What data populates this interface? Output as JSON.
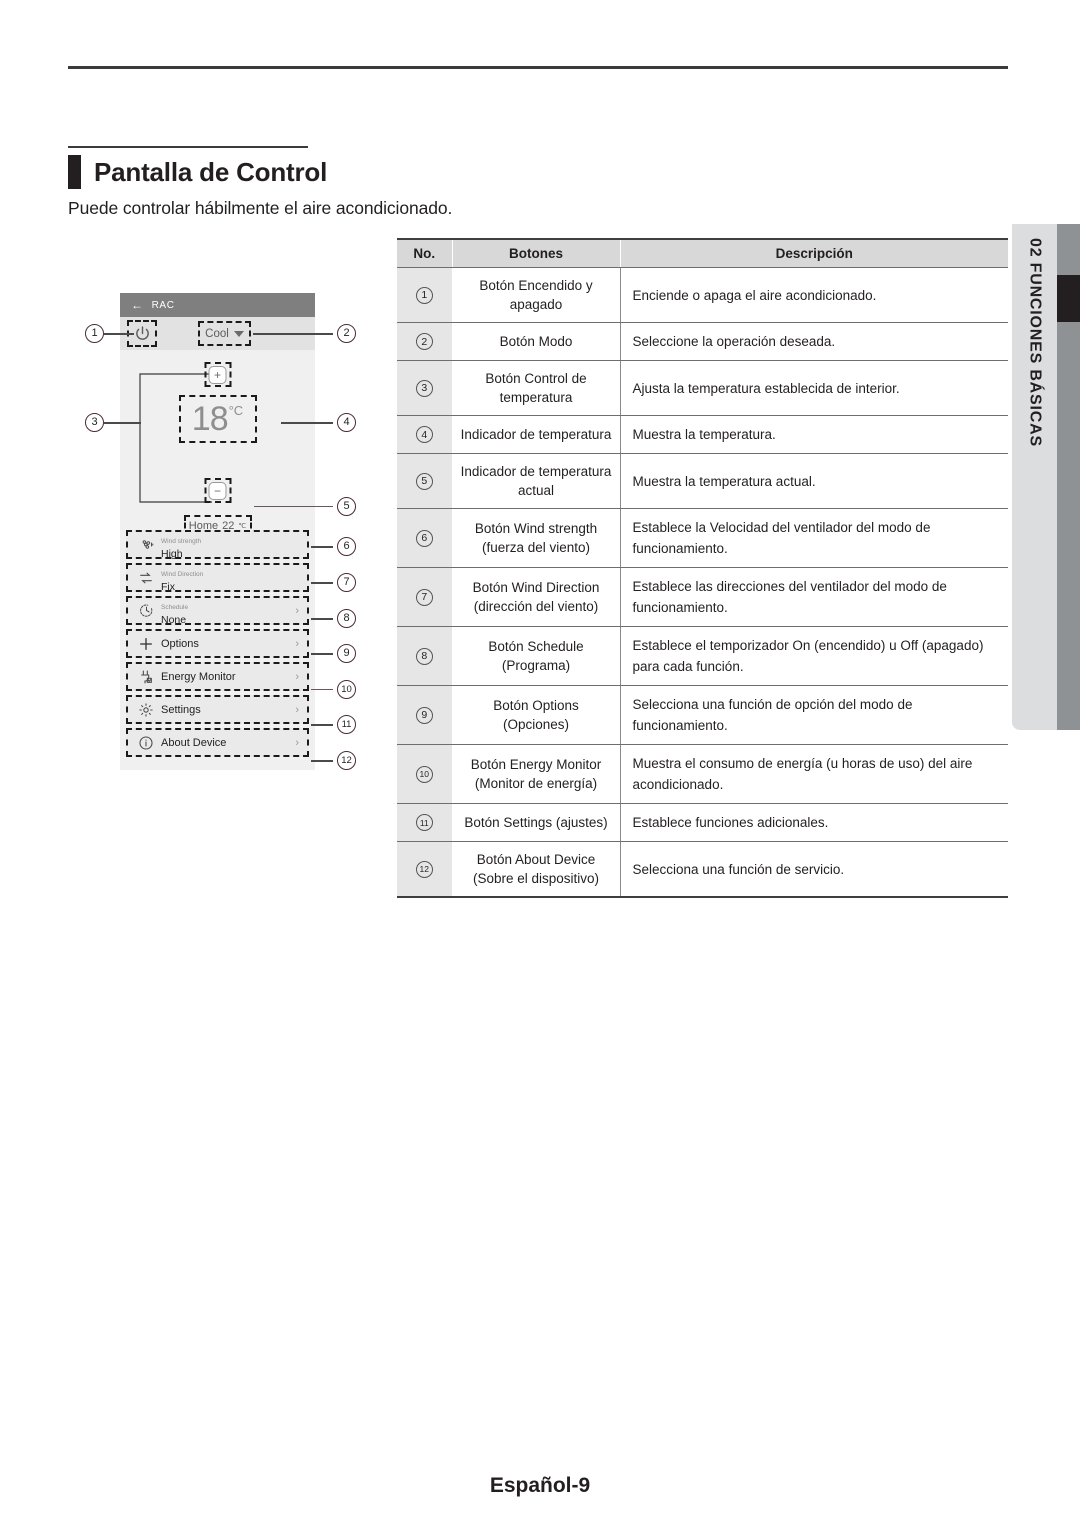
{
  "page": {
    "heading": "Pantalla de Control",
    "subtitle": "Puede controlar hábilmente el aire acondicionado.",
    "footer": "Español-9"
  },
  "sidebar": {
    "chapter_number": "02",
    "chapter_title": "FUNCIONES BÁSICAS",
    "label": "02  FUNCIONES BÁSICAS"
  },
  "mockup": {
    "appbar": {
      "back_icon": "back-arrow-icon",
      "title": "RAC"
    },
    "toolbar": {
      "power_icon": "power-icon",
      "mode_value": "Cool",
      "mode_caret": "chevron-down-icon"
    },
    "temperature": {
      "increase_label": "+",
      "decrease_label": "−",
      "set_value": "18",
      "set_unit": "°C",
      "current_label": "Home",
      "current_value": "22",
      "current_unit": "℃"
    },
    "list": [
      {
        "icon": "fan-icon",
        "label": "Wind strength",
        "value": "High",
        "chevron": false
      },
      {
        "icon": "arrows-icon",
        "label": "Wind Direction",
        "value": "Fix",
        "chevron": false
      },
      {
        "icon": "clock-icon",
        "label": "Schedule",
        "value": "None",
        "chevron": true
      },
      {
        "icon": "plus-icon",
        "label": "",
        "value": "Options",
        "chevron": true
      },
      {
        "icon": "plug-icon",
        "label": "",
        "value": "Energy Monitor",
        "chevron": true
      },
      {
        "icon": "gear-icon",
        "label": "",
        "value": "Settings",
        "chevron": true
      },
      {
        "icon": "info-icon",
        "label": "",
        "value": "About Device",
        "chevron": true
      }
    ],
    "callouts": [
      "1",
      "2",
      "3",
      "4",
      "5",
      "6",
      "7",
      "8",
      "9",
      "10",
      "11",
      "12"
    ]
  },
  "table": {
    "headers": [
      "No.",
      "Botones",
      "Descripción"
    ],
    "rows": [
      {
        "no": "1",
        "button": "Botón Encendido y apagado",
        "description": "Enciende o apaga el aire acondicionado."
      },
      {
        "no": "2",
        "button": "Botón Modo",
        "description": "Seleccione la operación deseada."
      },
      {
        "no": "3",
        "button": "Botón Control de temperatura",
        "description": "Ajusta la temperatura establecida de interior."
      },
      {
        "no": "4",
        "button": "Indicador de temperatura",
        "description": "Muestra la temperatura."
      },
      {
        "no": "5",
        "button": "Indicador de temperatura actual",
        "description": "Muestra la temperatura actual."
      },
      {
        "no": "6",
        "button": "Botón Wind strength (fuerza del viento)",
        "description": "Establece la Velocidad del ventilador del modo de funcionamiento."
      },
      {
        "no": "7",
        "button": "Botón Wind Direction (dirección del viento)",
        "description": "Establece las direcciones del ventilador del modo de funcionamiento."
      },
      {
        "no": "8",
        "button": "Botón Schedule (Programa)",
        "description": "Establece el temporizador On (encendido) u Off (apagado) para cada función."
      },
      {
        "no": "9",
        "button": "Botón Options (Opciones)",
        "description": "Selecciona una función de opción del modo de funcionamiento."
      },
      {
        "no": "10",
        "button": "Botón Energy Monitor (Monitor de energía)",
        "description": "Muestra el consumo de energía (u horas de uso) del aire acondicionado."
      },
      {
        "no": "11",
        "button": "Botón Settings (ajustes)",
        "description": "Establece funciones adicionales."
      },
      {
        "no": "12",
        "button": "Botón About Device (Sobre el dispositivo)",
        "description": "Selecciona una función de servicio."
      }
    ]
  },
  "colors": {
    "ink": "#231f20",
    "header_gray": "#d8d8d8",
    "no_col_gray": "#e6e6e6",
    "tab_gray": "#dcdddf",
    "strip_gray": "#8e9295",
    "appbar_gray": "#7f7f7f"
  }
}
